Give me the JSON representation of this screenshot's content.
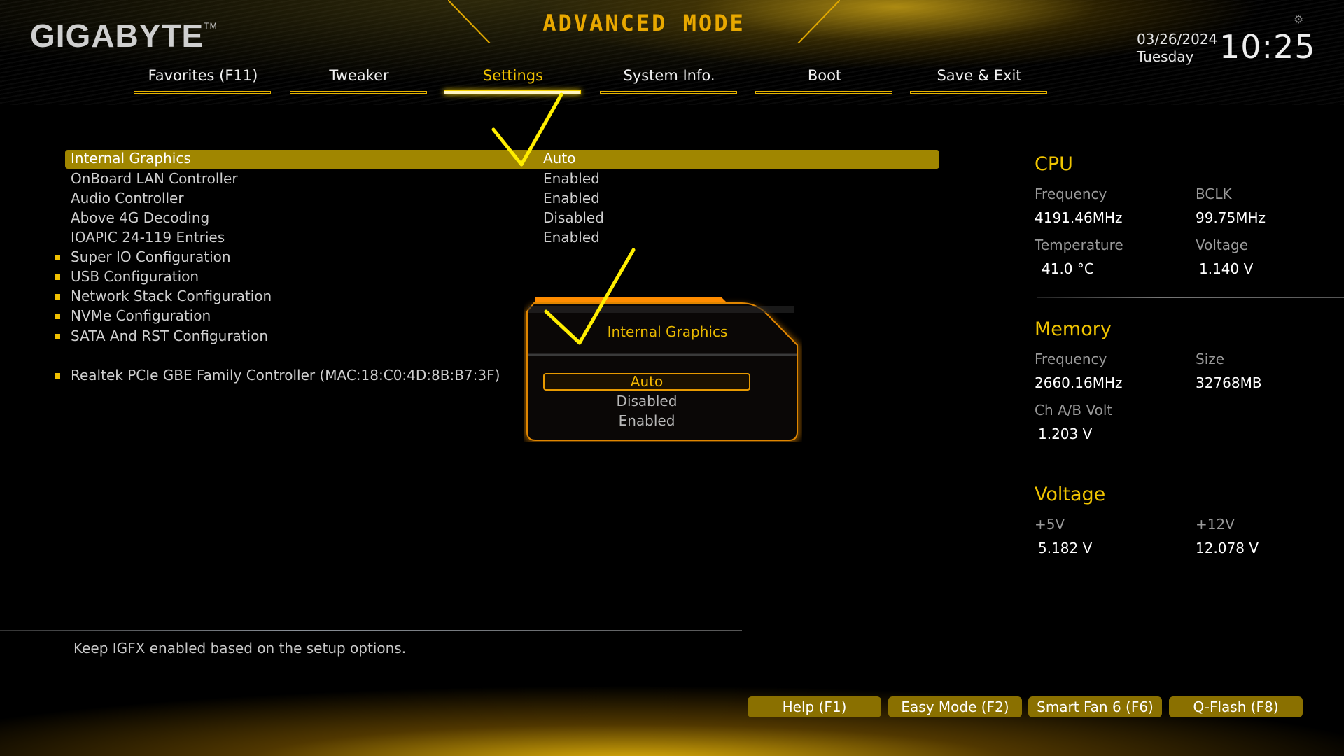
{
  "header": {
    "brand": "GIGABYTE",
    "trademark": "TM",
    "mode_title": "ADVANCED MODE",
    "date": "03/26/2024",
    "weekday": "Tuesday",
    "time": "10:25",
    "settings_icon": "gear-icon"
  },
  "tabs": [
    {
      "label": "Favorites (F11)",
      "active": false
    },
    {
      "label": "Tweaker",
      "active": false
    },
    {
      "label": "Settings",
      "active": true
    },
    {
      "label": "System Info.",
      "active": false
    },
    {
      "label": "Boot",
      "active": false
    },
    {
      "label": "Save & Exit",
      "active": false
    }
  ],
  "settings": {
    "items": [
      {
        "label": "Internal Graphics",
        "value": "Auto",
        "selected": true,
        "submenu": false
      },
      {
        "label": "OnBoard LAN Controller",
        "value": "Enabled",
        "submenu": false
      },
      {
        "label": "Audio Controller",
        "value": "Enabled",
        "submenu": false
      },
      {
        "label": "Above 4G Decoding",
        "value": "Disabled",
        "submenu": false
      },
      {
        "label": "IOAPIC 24-119 Entries",
        "value": "Enabled",
        "submenu": false
      },
      {
        "label": "Super IO Configuration",
        "submenu": true
      },
      {
        "label": "USB Configuration",
        "submenu": true
      },
      {
        "label": "Network Stack Configuration",
        "submenu": true
      },
      {
        "label": "NVMe Configuration",
        "submenu": true
      },
      {
        "label": "SATA And RST Configuration",
        "submenu": true
      },
      {
        "label": "Realtek PCIe GBE Family Controller (MAC:18:C0:4D:8B:B7:3F)",
        "submenu": true
      }
    ]
  },
  "popup": {
    "title": "Internal Graphics",
    "options": [
      "Auto",
      "Disabled",
      "Enabled"
    ],
    "selected": "Auto"
  },
  "annotations": {
    "checkmark_color": "#ffee00"
  },
  "cpu": {
    "title": "CPU",
    "frequency_label": "Frequency",
    "frequency": "4191.46MHz",
    "bclk_label": "BCLK",
    "bclk": "99.75MHz",
    "temperature_label": "Temperature",
    "temperature": "41.0 °C",
    "voltage_label": "Voltage",
    "voltage": "1.140 V"
  },
  "memory": {
    "title": "Memory",
    "frequency_label": "Frequency",
    "frequency": "2660.16MHz",
    "size_label": "Size",
    "size": "32768MB",
    "chab_label": "Ch A/B Volt",
    "chab": "1.203 V"
  },
  "voltage": {
    "title": "Voltage",
    "v5_label": "+5V",
    "v5": "5.182 V",
    "v12_label": "+12V",
    "v12": "12.078 V"
  },
  "help_text": "Keep IGFX enabled based on the setup options.",
  "footer_buttons": [
    {
      "label": "Help (F1)"
    },
    {
      "label": "Easy Mode (F2)"
    },
    {
      "label": "Smart Fan 6 (F6)"
    },
    {
      "label": "Q-Flash (F8)"
    }
  ],
  "colors": {
    "accent": "#f0c400",
    "highlight_row": "#a08600",
    "popup_border": "#e89a00"
  }
}
